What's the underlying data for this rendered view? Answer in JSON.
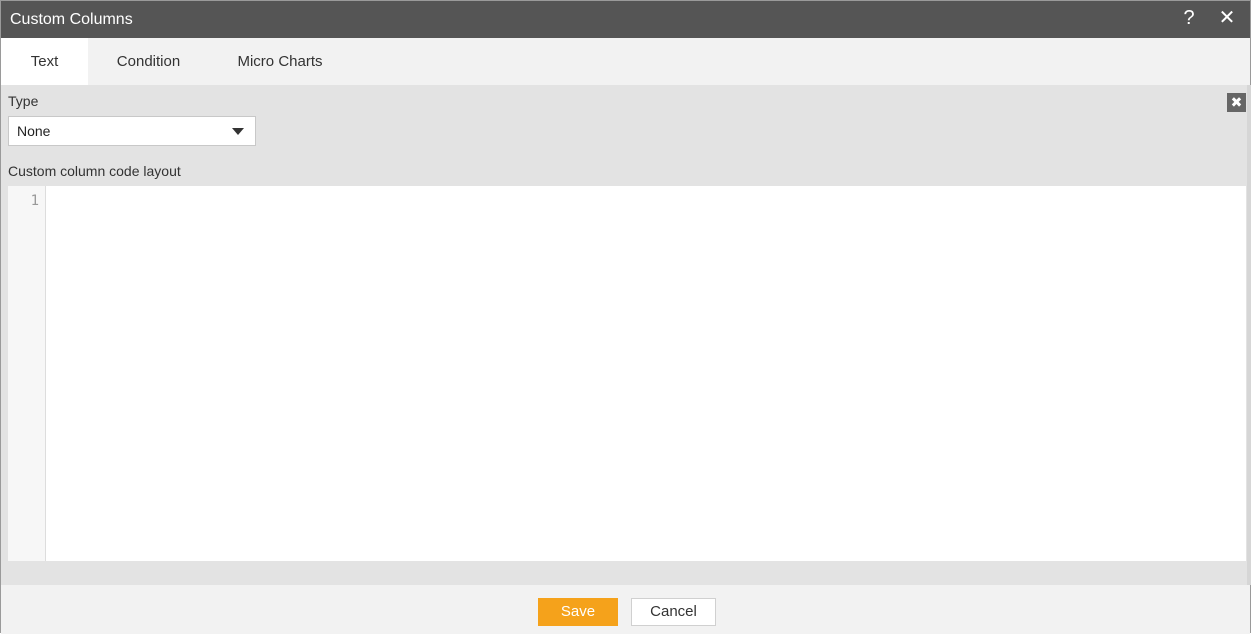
{
  "dialog": {
    "title": "Custom Columns",
    "help_icon": "?",
    "close_icon": "✕"
  },
  "tabs": [
    {
      "label": "Text",
      "active": true
    },
    {
      "label": "Condition",
      "active": false
    },
    {
      "label": "Micro Charts",
      "active": false
    }
  ],
  "panel": {
    "close_icon": "✖",
    "type_label": "Type",
    "type_value": "None",
    "code_label": "Custom column code layout",
    "line_numbers": [
      "1"
    ]
  },
  "footer": {
    "save_label": "Save",
    "cancel_label": "Cancel"
  },
  "colors": {
    "titlebar": "#555555",
    "accent": "#f5a21b"
  }
}
